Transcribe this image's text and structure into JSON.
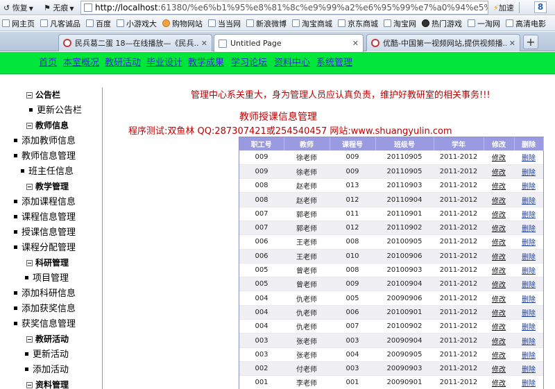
{
  "browser": {
    "restore_label": "恢复",
    "nomark_label": "无痕",
    "url_host": "http://localhost",
    "url_rest": ":61380/%e6%b1%95%e8%81%8c%e9%99%a2%e6%95%99%e7%a0%94%e5%ae%",
    "accel_label": "加速",
    "search_logo": "8",
    "bookmarks": [
      "网主页",
      "凡客诚品",
      "百度",
      "小游戏大",
      "购物网站",
      "当当网",
      "新浪微博",
      "淘宝商城",
      "京东商城",
      "淘宝网",
      "热门游戏",
      "一淘网",
      "高清电影"
    ],
    "tabs": [
      {
        "title": "民兵葛二蛋 18—在线播放—《民兵..."
      },
      {
        "title": "Untitled Page"
      },
      {
        "title": "优酷-中国第一视频网站,提供视频播..."
      }
    ],
    "new_tab_label": "+",
    "close_glyph": "✕"
  },
  "topnav": [
    "首页",
    "本室概况",
    "教研活动",
    "毕业设计",
    "教学成果",
    "学习论坛",
    "资料中心",
    "系统管理"
  ],
  "sidebar": {
    "groups": [
      {
        "title": "公告栏",
        "items": [
          "更新公告栏"
        ]
      },
      {
        "title": "教师信息",
        "items": [
          "添加教师信息",
          "教师信息管理",
          "班主任信息"
        ]
      },
      {
        "title": "教学管理",
        "items": [
          "添加课程信息",
          "课程信息管理",
          "授课信息管理",
          "课程分配管理"
        ]
      },
      {
        "title": "科研管理",
        "items": [
          "项目管理",
          "添加科研信息",
          "添加获奖信息",
          "获奖信息管理"
        ]
      },
      {
        "title": "教研活动",
        "items": [
          "更新活动",
          "添加活动"
        ]
      },
      {
        "title": "资料管理",
        "items": []
      }
    ]
  },
  "main": {
    "notice": "管理中心系关重大，身为管理人员应认真负责，维护好教研室的相关事务!!!",
    "section_title": "教师授课信息管理",
    "credit": "程序测试:双鱼林 QQ:287307421或254540457 网站:www.shuangyulin.com"
  },
  "grid": {
    "headers": [
      "职工号",
      "教师",
      "课程号",
      "班级号",
      "学年",
      "修改",
      "删除"
    ],
    "edit_label": "修改",
    "delete_label": "删除",
    "rows": [
      [
        "009",
        "徐老师",
        "009",
        "20110905",
        "2011-2012"
      ],
      [
        "009",
        "徐老师",
        "009",
        "20110905",
        "2011-2012"
      ],
      [
        "008",
        "赵老师",
        "013",
        "20110903",
        "2011-2012"
      ],
      [
        "008",
        "赵老师",
        "012",
        "20110904",
        "2011-2012"
      ],
      [
        "007",
        "郭老师",
        "011",
        "20110901",
        "2011-2012"
      ],
      [
        "007",
        "郭老师",
        "012",
        "20110902",
        "2011-2012"
      ],
      [
        "006",
        "王老师",
        "008",
        "20100905",
        "2011-2012"
      ],
      [
        "006",
        "王老师",
        "010",
        "20100906",
        "2011-2012"
      ],
      [
        "005",
        "曾老师",
        "008",
        "20100903",
        "2011-2012"
      ],
      [
        "005",
        "曾老师",
        "009",
        "20100904",
        "2011-2012"
      ],
      [
        "004",
        "仇老师",
        "005",
        "20090906",
        "2011-2012"
      ],
      [
        "004",
        "仇老师",
        "006",
        "20100901",
        "2011-2012"
      ],
      [
        "004",
        "仇老师",
        "007",
        "20100902",
        "2011-2012"
      ],
      [
        "003",
        "张老师",
        "003",
        "20090904",
        "2011-2012"
      ],
      [
        "003",
        "张老师",
        "004",
        "20090905",
        "2011-2012"
      ],
      [
        "002",
        "付老师",
        "003",
        "20090903",
        "2011-2012"
      ],
      [
        "001",
        "李老师",
        "001",
        "20090901",
        "2011-2012"
      ]
    ]
  },
  "colors": {
    "nav_bg": "#00e63b",
    "nav_link": "#3030c8",
    "notice_red": "#c00000",
    "grid_header": "#9a9ae0"
  }
}
